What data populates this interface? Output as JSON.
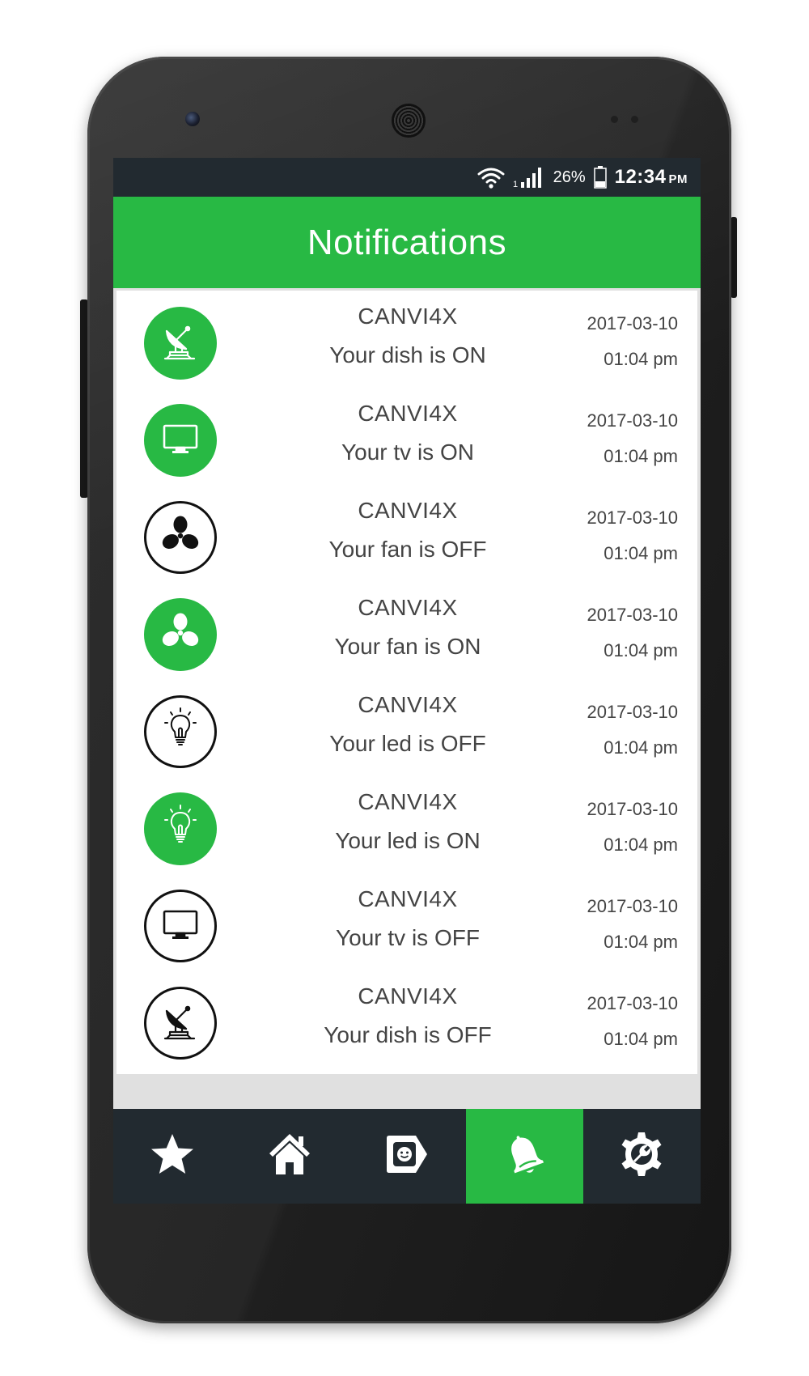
{
  "status_bar": {
    "battery_percent": "26%",
    "time": "12:34",
    "ampm": "PM",
    "signal_sub": "1"
  },
  "header": {
    "title": "Notifications"
  },
  "colors": {
    "accent": "#28b944",
    "dark": "#222a30",
    "row_bg": "#ffffff",
    "text": "#444444"
  },
  "notifications": [
    {
      "icon": "satellite-dish-icon",
      "state": "on",
      "app": "CANVI4X",
      "message": "Your dish is ON",
      "date": "2017-03-10",
      "time": "01:04 pm"
    },
    {
      "icon": "tv-icon",
      "state": "on",
      "app": "CANVI4X",
      "message": "Your tv is ON",
      "date": "2017-03-10",
      "time": "01:04 pm"
    },
    {
      "icon": "fan-icon",
      "state": "off",
      "app": "CANVI4X",
      "message": "Your fan is OFF",
      "date": "2017-03-10",
      "time": "01:04 pm"
    },
    {
      "icon": "fan-icon",
      "state": "on",
      "app": "CANVI4X",
      "message": "Your fan is ON",
      "date": "2017-03-10",
      "time": "01:04 pm"
    },
    {
      "icon": "bulb-icon",
      "state": "off",
      "app": "CANVI4X",
      "message": "Your led is OFF",
      "date": "2017-03-10",
      "time": "01:04 pm"
    },
    {
      "icon": "bulb-icon",
      "state": "on",
      "app": "CANVI4X",
      "message": "Your led is ON",
      "date": "2017-03-10",
      "time": "01:04 pm"
    },
    {
      "icon": "tv-icon",
      "state": "off",
      "app": "CANVI4X",
      "message": "Your tv is OFF",
      "date": "2017-03-10",
      "time": "01:04 pm"
    },
    {
      "icon": "satellite-dish-icon",
      "state": "off",
      "app": "CANVI4X",
      "message": "Your dish is OFF",
      "date": "2017-03-10",
      "time": "01:04 pm"
    }
  ],
  "bottom_nav": [
    {
      "icon": "star-icon",
      "active": false
    },
    {
      "icon": "home-icon",
      "active": false
    },
    {
      "icon": "tag-icon",
      "active": false
    },
    {
      "icon": "bell-icon",
      "active": true
    },
    {
      "icon": "settings-icon",
      "active": false
    }
  ]
}
